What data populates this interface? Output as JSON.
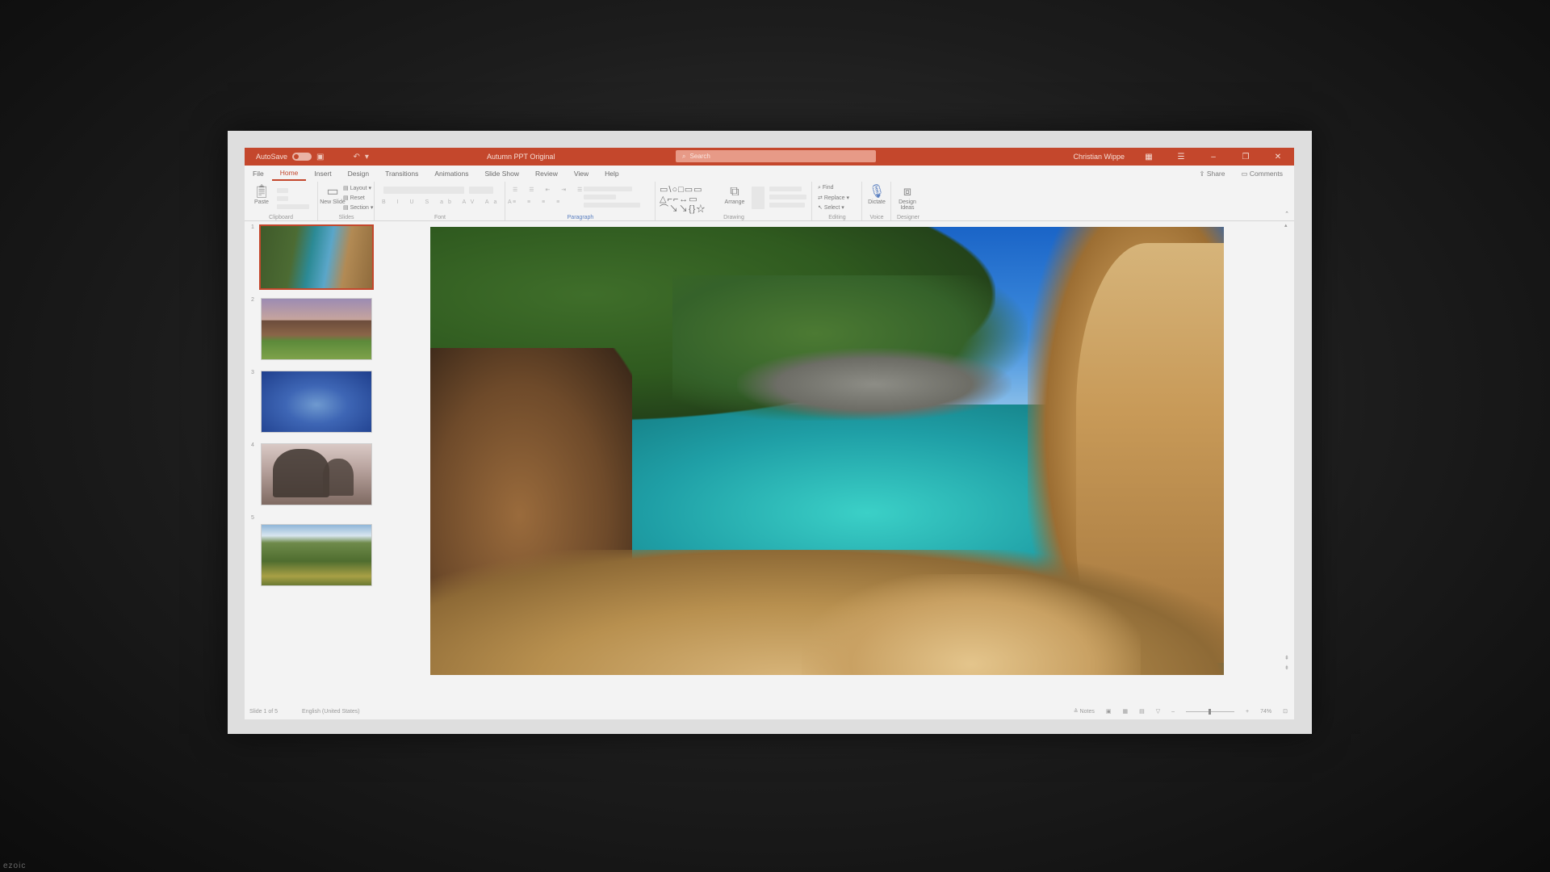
{
  "titlebar": {
    "autosave_label": "AutoSave",
    "autosave_state": "On",
    "document_title": "Autumn PPT Original",
    "search_placeholder": "Search",
    "user_name": "Christian Wippe",
    "accent_color": "#c4472c"
  },
  "menu": {
    "tabs": [
      "File",
      "Home",
      "Insert",
      "Design",
      "Transitions",
      "Animations",
      "Slide Show",
      "Review",
      "View",
      "Help"
    ],
    "active_tab": "Home",
    "share_label": "Share",
    "comments_label": "Comments"
  },
  "ribbon": {
    "clipboard": {
      "paste": "Paste",
      "label": "Clipboard"
    },
    "slides": {
      "new_slide": "New Slide",
      "layout": "Layout",
      "reset": "Reset",
      "section": "Section",
      "label": "Slides"
    },
    "font": {
      "label": "Font"
    },
    "paragraph": {
      "label": "Paragraph"
    },
    "drawing": {
      "arrange": "Arrange",
      "label": "Drawing"
    },
    "editing": {
      "find": "Find",
      "replace": "Replace",
      "select": "Select",
      "label": "Editing"
    },
    "voice": {
      "dictate": "Dictate",
      "label": "Voice"
    },
    "designer": {
      "design_ideas": "Design Ideas",
      "label": "Designer"
    }
  },
  "thumbnails": [
    {
      "number": "1",
      "icon": "coastal-cove-thumbnail",
      "selected": true
    },
    {
      "number": "2",
      "icon": "aqueduct-thumbnail",
      "selected": false
    },
    {
      "number": "3",
      "icon": "ocean-blue-thumbnail",
      "selected": false
    },
    {
      "number": "4",
      "icon": "trees-thumbnail",
      "selected": false
    },
    {
      "number": "5",
      "icon": "valley-thumbnail",
      "selected": false
    }
  ],
  "slide": {
    "image": "coastal-cove-photo"
  },
  "statusbar": {
    "slide_indicator": "Slide 1 of 5",
    "language": "English (United States)",
    "notes_label": "Notes",
    "zoom": "74%"
  },
  "watermark": "ezoic"
}
